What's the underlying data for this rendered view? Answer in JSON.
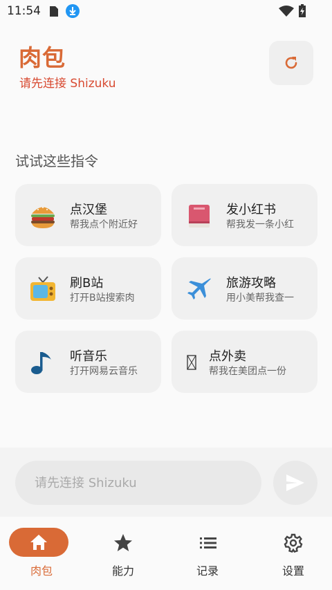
{
  "status_bar": {
    "time": "11:54"
  },
  "header": {
    "title": "肉包",
    "subtitle": "请先连接 Shizuku"
  },
  "section_title": "试试这些指令",
  "commands": [
    {
      "title": "点汉堡",
      "desc": "帮我点个附近好",
      "icon": "hamburger-icon"
    },
    {
      "title": "发小红书",
      "desc": "帮我发一条小红",
      "icon": "book-icon"
    },
    {
      "title": "刷B站",
      "desc": "打开B站搜索肉",
      "icon": "tv-icon"
    },
    {
      "title": "旅游攻略",
      "desc": "用小美帮我查一",
      "icon": "airplane-icon"
    },
    {
      "title": "听音乐",
      "desc": "打开网易云音乐",
      "icon": "music-note-icon"
    },
    {
      "title": "点外卖",
      "desc": "帮我在美团点一份",
      "icon": "missing-glyph-icon"
    }
  ],
  "input": {
    "placeholder": "请先连接 Shizuku"
  },
  "nav": [
    {
      "label": "肉包",
      "icon": "home-icon",
      "active": true
    },
    {
      "label": "能力",
      "icon": "star-icon",
      "active": false
    },
    {
      "label": "记录",
      "icon": "list-icon",
      "active": false
    },
    {
      "label": "设置",
      "icon": "gear-icon",
      "active": false
    }
  ],
  "colors": {
    "accent": "#d96a36",
    "subtitle_red": "#d84a31",
    "card_bg": "#f0f0f0"
  }
}
